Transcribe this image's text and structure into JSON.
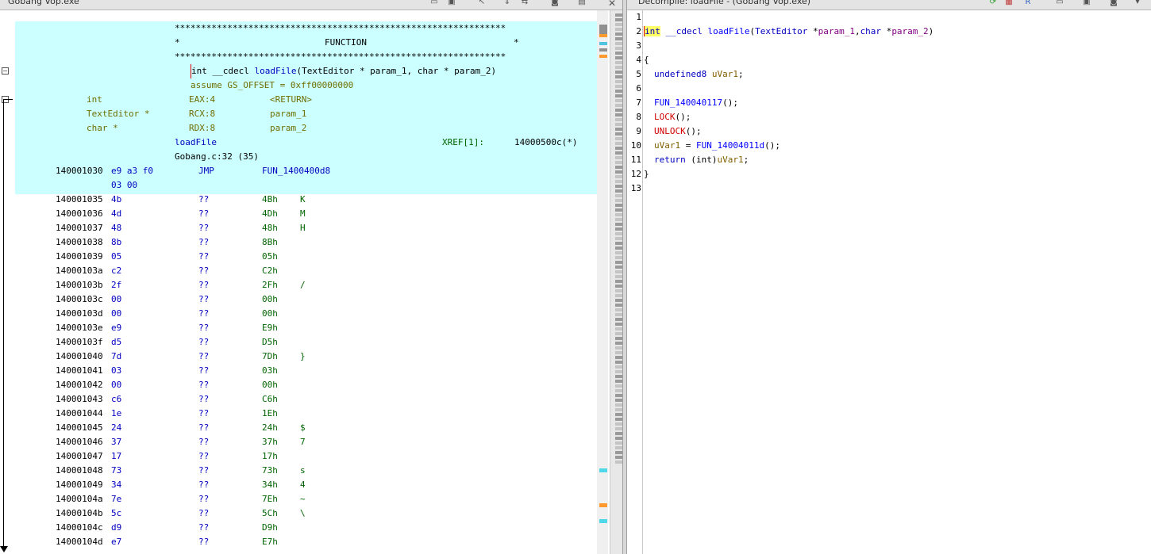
{
  "listing": {
    "title": "Gobang Vop.exe",
    "banner_stars": "***************************************************************",
    "banner_mid_left": "*",
    "banner_mid_text": "FUNCTION",
    "banner_mid_right": "*",
    "signature_type": "int __cdecl ",
    "signature_name": "loadFile",
    "signature_params": "(TextEditor * param_1, char * param_2)",
    "assume": "assume GS_OFFSET = 0xff00000000",
    "vars": [
      {
        "type": "int",
        "loc": "EAX:4",
        "name": "<RETURN>"
      },
      {
        "type": "TextEditor *",
        "loc": "RCX:8",
        "name": "param_1"
      },
      {
        "type": "char *",
        "loc": "RDX:8",
        "name": "param_2"
      }
    ],
    "label": "loadFile",
    "xref_label": "XREF[1]:",
    "xref_value": "14000500c(*)",
    "source": "Gobang.c:32 (35)",
    "jmp_row": {
      "addr": "140001030",
      "bytes1": "e9 a3 f0",
      "bytes2": "03 00",
      "mnemonic": "JMP",
      "operand": "FUN_1400400d8"
    },
    "rows": [
      {
        "addr": "140001035",
        "byte": "4b",
        "mn": "??",
        "val": "4Bh",
        "ch": "K"
      },
      {
        "addr": "140001036",
        "byte": "4d",
        "mn": "??",
        "val": "4Dh",
        "ch": "M"
      },
      {
        "addr": "140001037",
        "byte": "48",
        "mn": "??",
        "val": "48h",
        "ch": "H"
      },
      {
        "addr": "140001038",
        "byte": "8b",
        "mn": "??",
        "val": "8Bh",
        "ch": ""
      },
      {
        "addr": "140001039",
        "byte": "05",
        "mn": "??",
        "val": "05h",
        "ch": ""
      },
      {
        "addr": "14000103a",
        "byte": "c2",
        "mn": "??",
        "val": "C2h",
        "ch": ""
      },
      {
        "addr": "14000103b",
        "byte": "2f",
        "mn": "??",
        "val": "2Fh",
        "ch": "/"
      },
      {
        "addr": "14000103c",
        "byte": "00",
        "mn": "??",
        "val": "00h",
        "ch": ""
      },
      {
        "addr": "14000103d",
        "byte": "00",
        "mn": "??",
        "val": "00h",
        "ch": ""
      },
      {
        "addr": "14000103e",
        "byte": "e9",
        "mn": "??",
        "val": "E9h",
        "ch": ""
      },
      {
        "addr": "14000103f",
        "byte": "d5",
        "mn": "??",
        "val": "D5h",
        "ch": ""
      },
      {
        "addr": "140001040",
        "byte": "7d",
        "mn": "??",
        "val": "7Dh",
        "ch": "}"
      },
      {
        "addr": "140001041",
        "byte": "03",
        "mn": "??",
        "val": "03h",
        "ch": ""
      },
      {
        "addr": "140001042",
        "byte": "00",
        "mn": "??",
        "val": "00h",
        "ch": ""
      },
      {
        "addr": "140001043",
        "byte": "c6",
        "mn": "??",
        "val": "C6h",
        "ch": ""
      },
      {
        "addr": "140001044",
        "byte": "1e",
        "mn": "??",
        "val": "1Eh",
        "ch": ""
      },
      {
        "addr": "140001045",
        "byte": "24",
        "mn": "??",
        "val": "24h",
        "ch": "$"
      },
      {
        "addr": "140001046",
        "byte": "37",
        "mn": "??",
        "val": "37h",
        "ch": "7"
      },
      {
        "addr": "140001047",
        "byte": "17",
        "mn": "??",
        "val": "17h",
        "ch": ""
      },
      {
        "addr": "140001048",
        "byte": "73",
        "mn": "??",
        "val": "73h",
        "ch": "s"
      },
      {
        "addr": "140001049",
        "byte": "34",
        "mn": "??",
        "val": "34h",
        "ch": "4"
      },
      {
        "addr": "14000104a",
        "byte": "7e",
        "mn": "??",
        "val": "7Eh",
        "ch": "~"
      },
      {
        "addr": "14000104b",
        "byte": "5c",
        "mn": "??",
        "val": "5Ch",
        "ch": "\\"
      },
      {
        "addr": "14000104c",
        "byte": "d9",
        "mn": "??",
        "val": "D9h",
        "ch": ""
      },
      {
        "addr": "14000104d",
        "byte": "e7",
        "mn": "??",
        "val": "E7h",
        "ch": ""
      }
    ]
  },
  "decompile": {
    "title": "Decompile: loadFile - (Gobang Vop.exe)",
    "line_numbers": [
      "1",
      "2",
      "3",
      "4",
      "5",
      "6",
      "7",
      "8",
      "9",
      "10",
      "11",
      "12",
      "13"
    ],
    "sig_int": "int",
    "sig_cdecl": " __cdecl ",
    "sig_name": "loadFile",
    "sig_open": "(",
    "sig_t1": "TextEditor",
    "sig_star1": " *",
    "sig_p1": "param_1",
    "sig_comma": ",",
    "sig_t2": "char",
    "sig_star2": " *",
    "sig_p2": "param_2",
    "sig_close": ")",
    "open_brace": "{",
    "decl_type": "undefined8",
    "decl_var": "uVar1",
    "semi": ";",
    "call1": "FUN_140040117",
    "lock": "LOCK",
    "unlock": "UNLOCK",
    "assign_var": "uVar1",
    "assign_eq": " = ",
    "call2": "FUN_14004011d",
    "call_tail": "();",
    "ret_kw": "return",
    "ret_cast": " (int)",
    "ret_var": "uVar1",
    "close_brace": "}"
  },
  "colors": {
    "function_highlight": "#ccffff",
    "keyword": "#0000c0",
    "variable": "#806000",
    "macro": "#d00000"
  }
}
